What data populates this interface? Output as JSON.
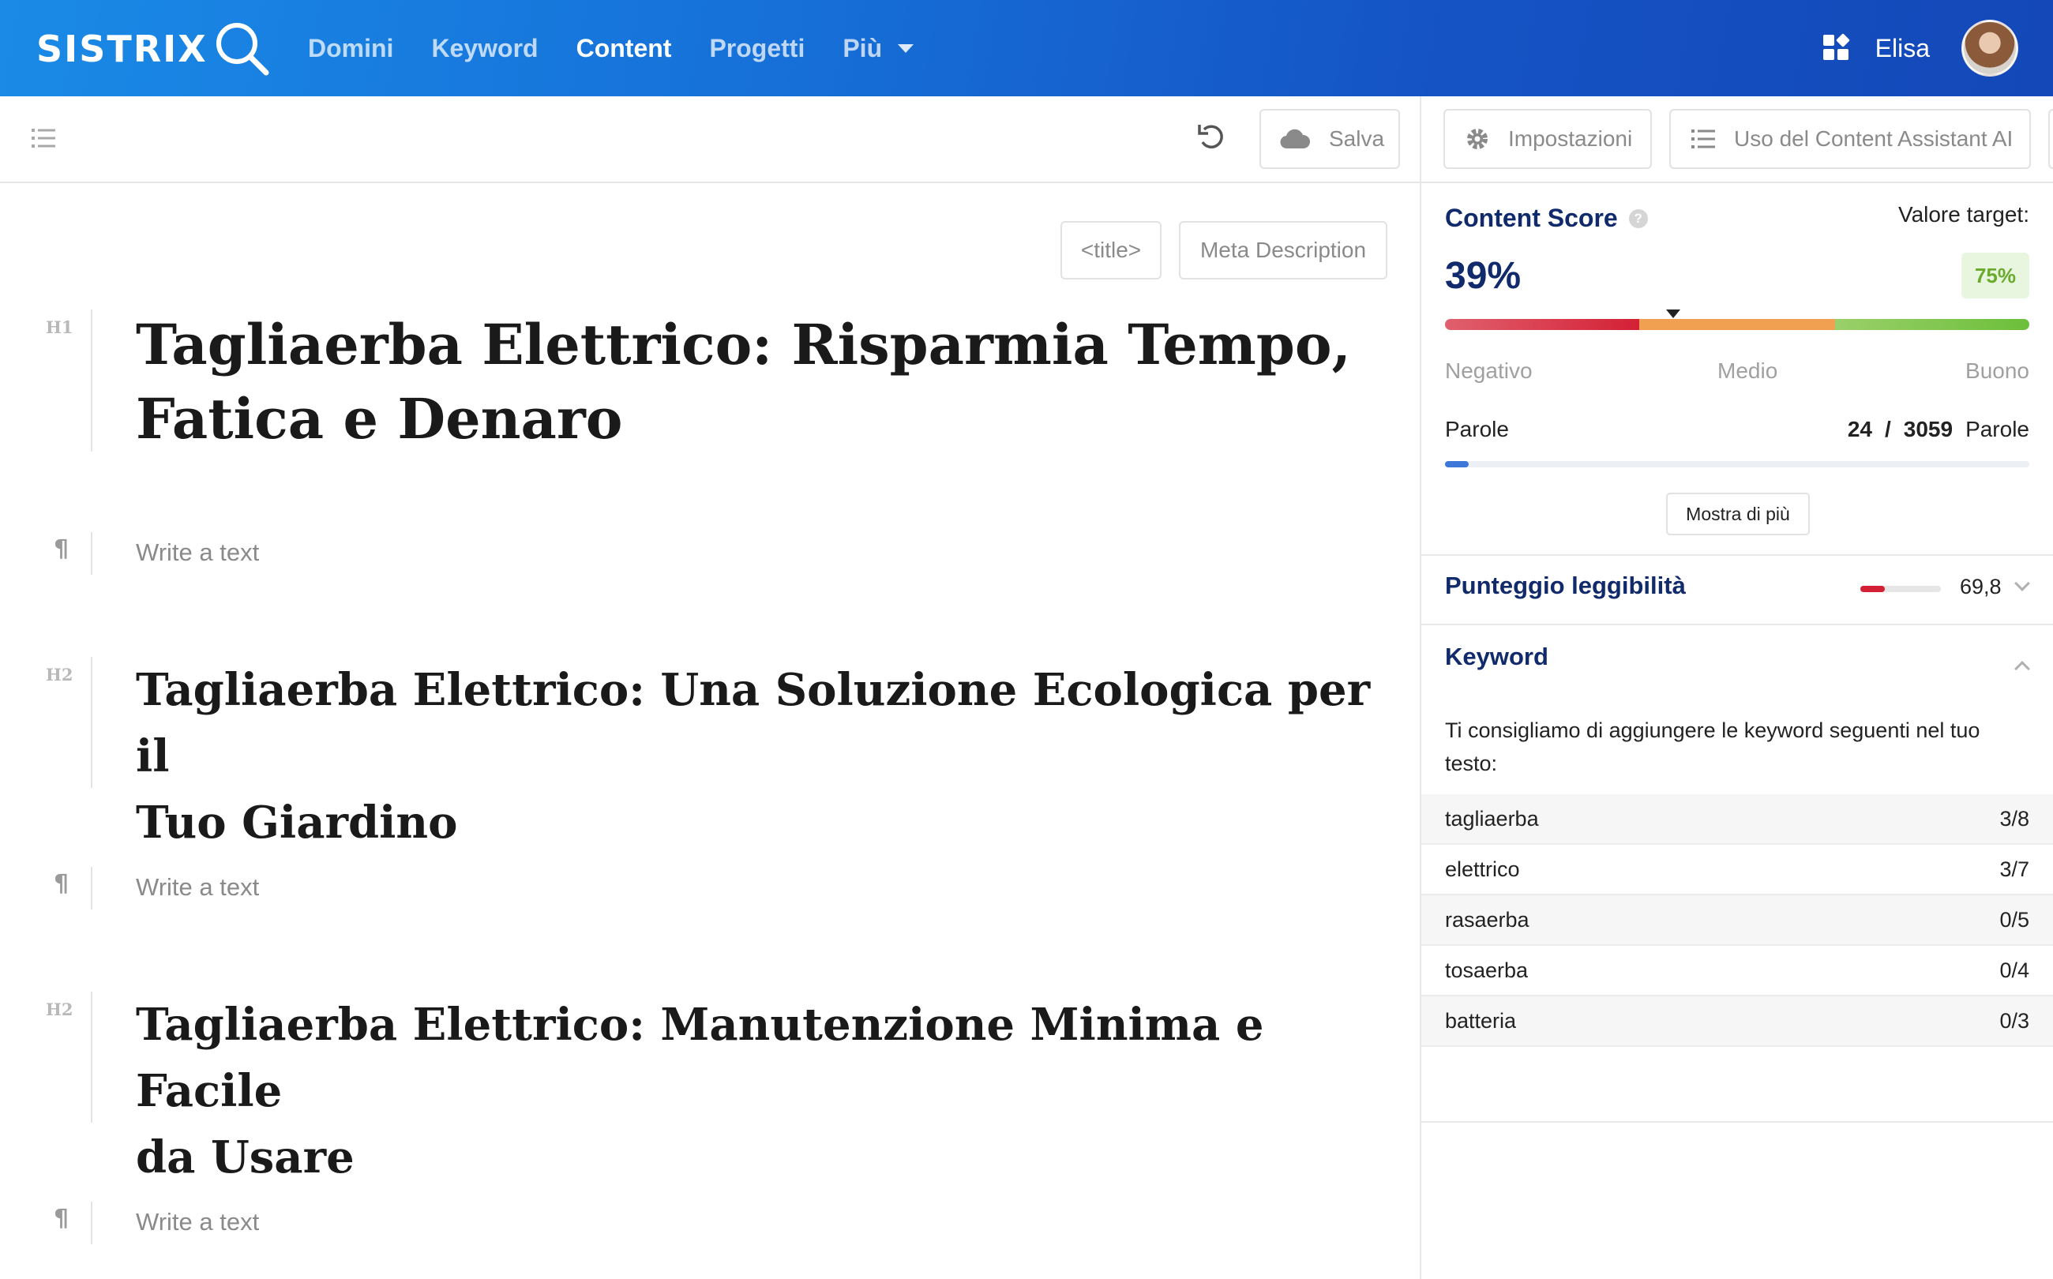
{
  "app": {
    "logo_text": "SISTRIX"
  },
  "nav": {
    "items": [
      {
        "label": "Domini"
      },
      {
        "label": "Keyword"
      },
      {
        "label": "Content"
      },
      {
        "label": "Progetti"
      },
      {
        "label": "Più"
      }
    ],
    "active": "Content"
  },
  "user": {
    "name": "Elisa"
  },
  "toolbar": {
    "save_label": "Salva",
    "settings_label": "Impostazioni",
    "usage_label": "Uso del Content Assistant AI"
  },
  "editor": {
    "title_tag_label": "<title>",
    "meta_label": "Meta Description",
    "blocks": [
      {
        "type": "H1",
        "marker": "H1",
        "text_line1": "Tagliaerba Elettrico: Risparmia Tempo,",
        "text_line2": "Fatica e Denaro"
      },
      {
        "type": "p",
        "text": "Write a text"
      },
      {
        "type": "H2",
        "marker": "H2",
        "text_line1": "Tagliaerba Elettrico: Una Soluzione Ecologica per il",
        "text_line2": "Tuo Giardino"
      },
      {
        "type": "p",
        "text": "Write a text"
      },
      {
        "type": "H2",
        "marker": "H2",
        "text_line1": "Tagliaerba Elettrico: Manutenzione Minima e Facile",
        "text_line2": "da Usare"
      },
      {
        "type": "p",
        "text": "Write a text"
      }
    ],
    "paragraph_icon": "¶"
  },
  "panel": {
    "content_score": {
      "title": "Content Score",
      "help": "?",
      "target_label": "Valore target:",
      "score_text": "39%",
      "score_value": 39,
      "target_text": "75%",
      "scale": {
        "low": "Negativo",
        "mid": "Medio",
        "high": "Buono"
      }
    },
    "words": {
      "label": "Parole",
      "current": "24",
      "separator": "/",
      "target": "3059",
      "unit": "Parole",
      "progress_fraction": 0.008
    },
    "more_label": "Mostra di più",
    "readability": {
      "title": "Punteggio leggibilità",
      "value": "69,8",
      "bar_fraction": 0.3
    },
    "keywords": {
      "title": "Keyword",
      "description": "Ti consigliamo di aggiungere le keyword seguenti nel tuo testo:",
      "rows": [
        {
          "term": "tagliaerba",
          "count": "3/8"
        },
        {
          "term": "elettrico",
          "count": "3/7"
        },
        {
          "term": "rasaerba",
          "count": "0/5"
        },
        {
          "term": "tosaerba",
          "count": "0/4"
        },
        {
          "term": "batteria",
          "count": "0/3"
        }
      ]
    }
  },
  "colors": {
    "nav_gradient_start": "#1a8ae6",
    "nav_gradient_end": "#1448b8",
    "accent_dark_blue": "#102a6b",
    "bad_red": "#d42035",
    "medium_orange": "#f0a050",
    "good_green": "#6cbf3a"
  },
  "icons": [
    "search-magnifier-icon",
    "apps-grid-icon",
    "outline-list-icon",
    "undo-icon",
    "cloud-icon",
    "gear-icon",
    "list-icon",
    "paragraph-icon",
    "help-icon",
    "chevron-down-icon",
    "chevron-up-icon"
  ]
}
